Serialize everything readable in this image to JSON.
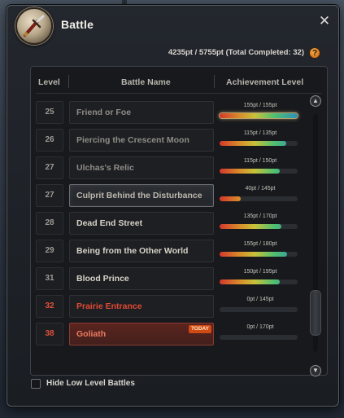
{
  "window": {
    "title": "Battle",
    "close_glyph": "✕"
  },
  "summary": {
    "text": "4235pt / 5755pt (Total Completed:  32)",
    "help_glyph": "?"
  },
  "columns": {
    "level": "Level",
    "battle_name": "Battle Name",
    "achievement": "Achievement Level"
  },
  "battles": [
    {
      "level": "25",
      "name": "Friend or Foe",
      "achievement": "155pt / 155pt",
      "progress": 1.0,
      "state": "normal"
    },
    {
      "level": "26",
      "name": "Piercing the Crescent Moon",
      "achievement": "115pt / 135pt",
      "progress": 0.852,
      "state": "normal"
    },
    {
      "level": "27",
      "name": "Ulchas's Relic",
      "achievement": "115pt / 150pt",
      "progress": 0.767,
      "state": "normal"
    },
    {
      "level": "27",
      "name": "Culprit Behind the Disturbance",
      "achievement": "40pt / 145pt",
      "progress": 0.276,
      "state": "selected"
    },
    {
      "level": "28",
      "name": "Dead End Street",
      "achievement": "135pt / 170pt",
      "progress": 0.794,
      "state": "bright"
    },
    {
      "level": "29",
      "name": "Being from the Other World",
      "achievement": "155pt / 180pt",
      "progress": 0.861,
      "state": "bright"
    },
    {
      "level": "31",
      "name": "Blood Prince",
      "achievement": "150pt / 195pt",
      "progress": 0.769,
      "state": "bright"
    },
    {
      "level": "32",
      "name": "Prairie Entrance",
      "achievement": "0pt / 145pt",
      "progress": 0.0,
      "state": "red"
    },
    {
      "level": "38",
      "name": "Goliath",
      "achievement": "0pt / 170pt",
      "progress": 0.0,
      "state": "goliath",
      "badge": "TODAY"
    }
  ],
  "scroll": {
    "up_glyph": "▲",
    "down_glyph": "▼"
  },
  "filter": {
    "hide_low_level_label": "Hide Low Level Battles",
    "checked": false
  },
  "colors": {
    "accent_red": "#e14a33",
    "today_badge": "#cf4a14"
  }
}
